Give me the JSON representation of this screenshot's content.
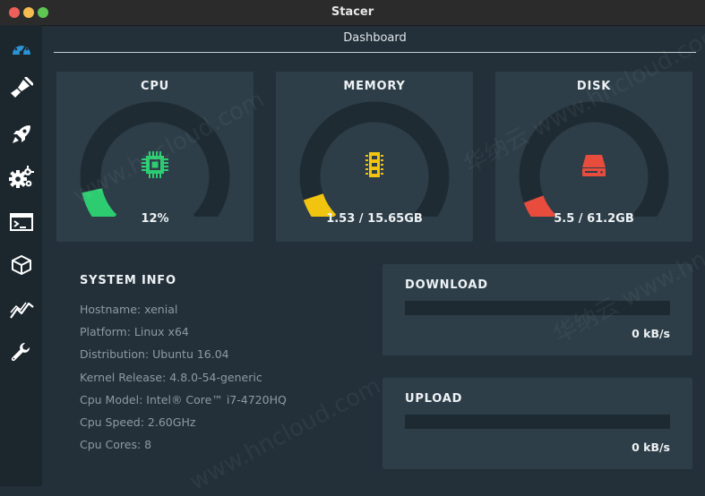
{
  "window": {
    "title": "Stacer"
  },
  "header": {
    "title": "Dashboard"
  },
  "sidebar": {
    "items": [
      {
        "name": "dashboard",
        "icon": "dashboard-icon",
        "color": "#2a94d6"
      },
      {
        "name": "system-cleaner",
        "icon": "broom-icon"
      },
      {
        "name": "startup-apps",
        "icon": "rocket-icon"
      },
      {
        "name": "services",
        "icon": "gears-icon"
      },
      {
        "name": "processes",
        "icon": "terminal-icon"
      },
      {
        "name": "uninstaller",
        "icon": "package-icon"
      },
      {
        "name": "resources",
        "icon": "chart-line-icon"
      },
      {
        "name": "settings",
        "icon": "wrench-icon"
      }
    ]
  },
  "gauges": [
    {
      "label": "CPU",
      "value": "12%",
      "percent": 12,
      "color": "#2ecc71",
      "icon": "cpu-chip-icon"
    },
    {
      "label": "MEMORY",
      "value": "1.53 / 15.65GB",
      "percent": 9.8,
      "color": "#f1c40f",
      "icon": "memory-module-icon"
    },
    {
      "label": "DISK",
      "value": "5.5 / 61.2GB",
      "percent": 9.0,
      "color": "#e74c3c",
      "icon": "hard-disk-icon"
    }
  ],
  "system_info": {
    "heading": "SYSTEM INFO",
    "lines": [
      "Hostname: xenial",
      "Platform: Linux x64",
      "Distribution: Ubuntu 16.04",
      "Kernel Release: 4.8.0-54-generic",
      "Cpu Model: Intel® Core™ i7-4720HQ",
      "Cpu Speed: 2.60GHz",
      "Cpu Cores: 8"
    ]
  },
  "network": {
    "download": {
      "label": "DOWNLOAD",
      "value": "0 kB/s",
      "fill_percent": 0
    },
    "upload": {
      "label": "UPLOAD",
      "value": "0 kB/s",
      "fill_percent": 0
    }
  },
  "watermarks": [
    "www.hncloud.com",
    "华纳云 www.hncloud.com",
    "www.hncloud.com",
    "华纳云 www.hncloud.com"
  ]
}
